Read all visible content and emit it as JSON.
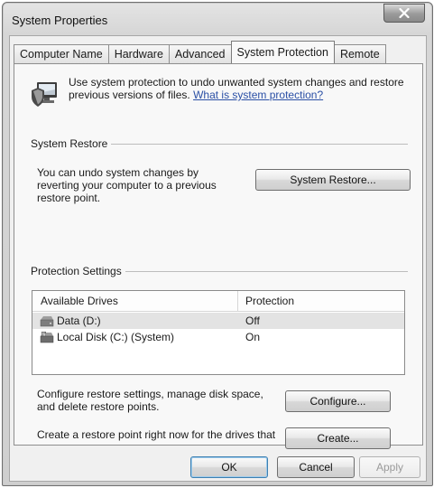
{
  "window": {
    "title": "System Properties",
    "close_label": "X"
  },
  "tabs": [
    {
      "label": "Computer Name",
      "active": false
    },
    {
      "label": "Hardware",
      "active": false
    },
    {
      "label": "Advanced",
      "active": false
    },
    {
      "label": "System Protection",
      "active": true
    },
    {
      "label": "Remote",
      "active": false
    }
  ],
  "intro": {
    "text": "Use system protection to undo unwanted system changes and restore previous versions of files.",
    "link": "What is system protection?",
    "icon": "shield-computer-icon"
  },
  "system_restore": {
    "group_label": "System Restore",
    "description": "You can undo system changes by reverting your computer to a previous restore point.",
    "button_label": "System Restore...",
    "button_mnemonic": "S"
  },
  "protection_settings": {
    "group_label": "Protection Settings",
    "columns": [
      "Available Drives",
      "Protection"
    ],
    "drives": [
      {
        "name": "Data (D:)",
        "protection": "Off",
        "icon": "drive-icon",
        "selected": true
      },
      {
        "name": "Local Disk (C:) (System)",
        "protection": "On",
        "icon": "system-drive-icon",
        "selected": false
      }
    ],
    "configure_text": "Configure restore settings, manage disk space, and delete restore points.",
    "configure_label": "Configure...",
    "create_text": "Create a restore point right now for the drives that have system protection turned on.",
    "create_label": "Create..."
  },
  "footer": {
    "ok": "OK",
    "cancel": "Cancel",
    "apply": "Apply"
  }
}
